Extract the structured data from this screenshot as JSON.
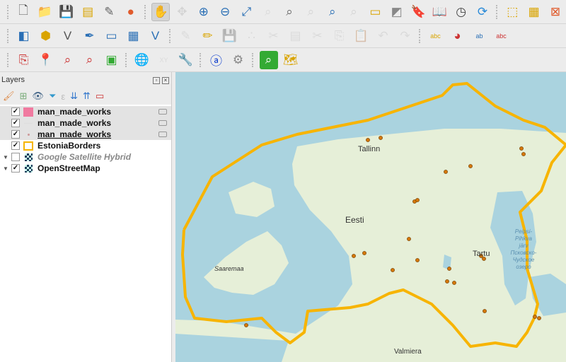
{
  "toolbars": [
    [
      "new-project",
      "open-project",
      "save-project",
      "new-print-layout",
      "style-manager",
      "style-manager-colors",
      "|",
      "pan-map",
      "pan-to-selection",
      "zoom-in",
      "zoom-out",
      "zoom-full",
      "zoom-to-selection",
      "zoom-to-layer",
      "zoom-native",
      "zoom-last",
      "zoom-next",
      "new-map-view",
      "new-3d-view",
      "new-bookmark",
      "show-bookmarks",
      "refresh-clock",
      "refresh",
      "|",
      "select-features",
      "attribute-table",
      "deselect"
    ],
    [
      "data-source-manager",
      "new-geopackage",
      "new-shapefile",
      "new-spatialite",
      "new-virtual-layer",
      "new-mesh",
      "new-temporary",
      "|",
      "digitize",
      "toggle-editing",
      "save-edits",
      "add-point",
      "vertex-tool",
      "delete",
      "cut",
      "copy",
      "paste",
      "undo",
      "redo",
      "|",
      "label-tool",
      "label-pin",
      "label-show",
      "label-move"
    ],
    [
      "add-layer",
      "pin",
      "identify",
      "identify-multi",
      "select-rect",
      "|",
      "globe",
      "xy-tool",
      "wrench",
      "|",
      "qgis-cloud",
      "processing",
      "|",
      "locator",
      "openlayers"
    ]
  ],
  "panel": {
    "title": "Layers"
  },
  "layers": [
    {
      "name": "man_made_works",
      "checked": true,
      "symbol": "polygon",
      "color": "#f07aa0",
      "selected": true
    },
    {
      "name": "man_made_works",
      "checked": true,
      "symbol": "line",
      "selected": true
    },
    {
      "name": "man_made_works",
      "checked": true,
      "symbol": "point",
      "selected": true,
      "underline": true
    },
    {
      "name": "EstoniaBorders",
      "checked": true,
      "symbol": "outline",
      "color": "#f5b400"
    },
    {
      "name": "Google Satellite Hybrid",
      "checked": false,
      "symbol": "raster",
      "italic": true,
      "group": true
    },
    {
      "name": "OpenStreetMap",
      "checked": true,
      "symbol": "raster",
      "group": true
    }
  ],
  "map": {
    "labels": {
      "tallinn": "Tallinn",
      "eesti": "Eesti",
      "saaremaa": "Saaremaa",
      "tartu": "Tartu",
      "valmiera": "Valmiera",
      "lake1": "Peipsi-",
      "lake2": "Pihkva",
      "lake3": "järv",
      "lake4": "Псковско-",
      "lake5": "Чудское",
      "lake6": "озеро"
    },
    "border_color": "#f7b400",
    "point_color": "#d4770a",
    "land_color": "#e6efd8",
    "water_color": "#aad3df"
  }
}
